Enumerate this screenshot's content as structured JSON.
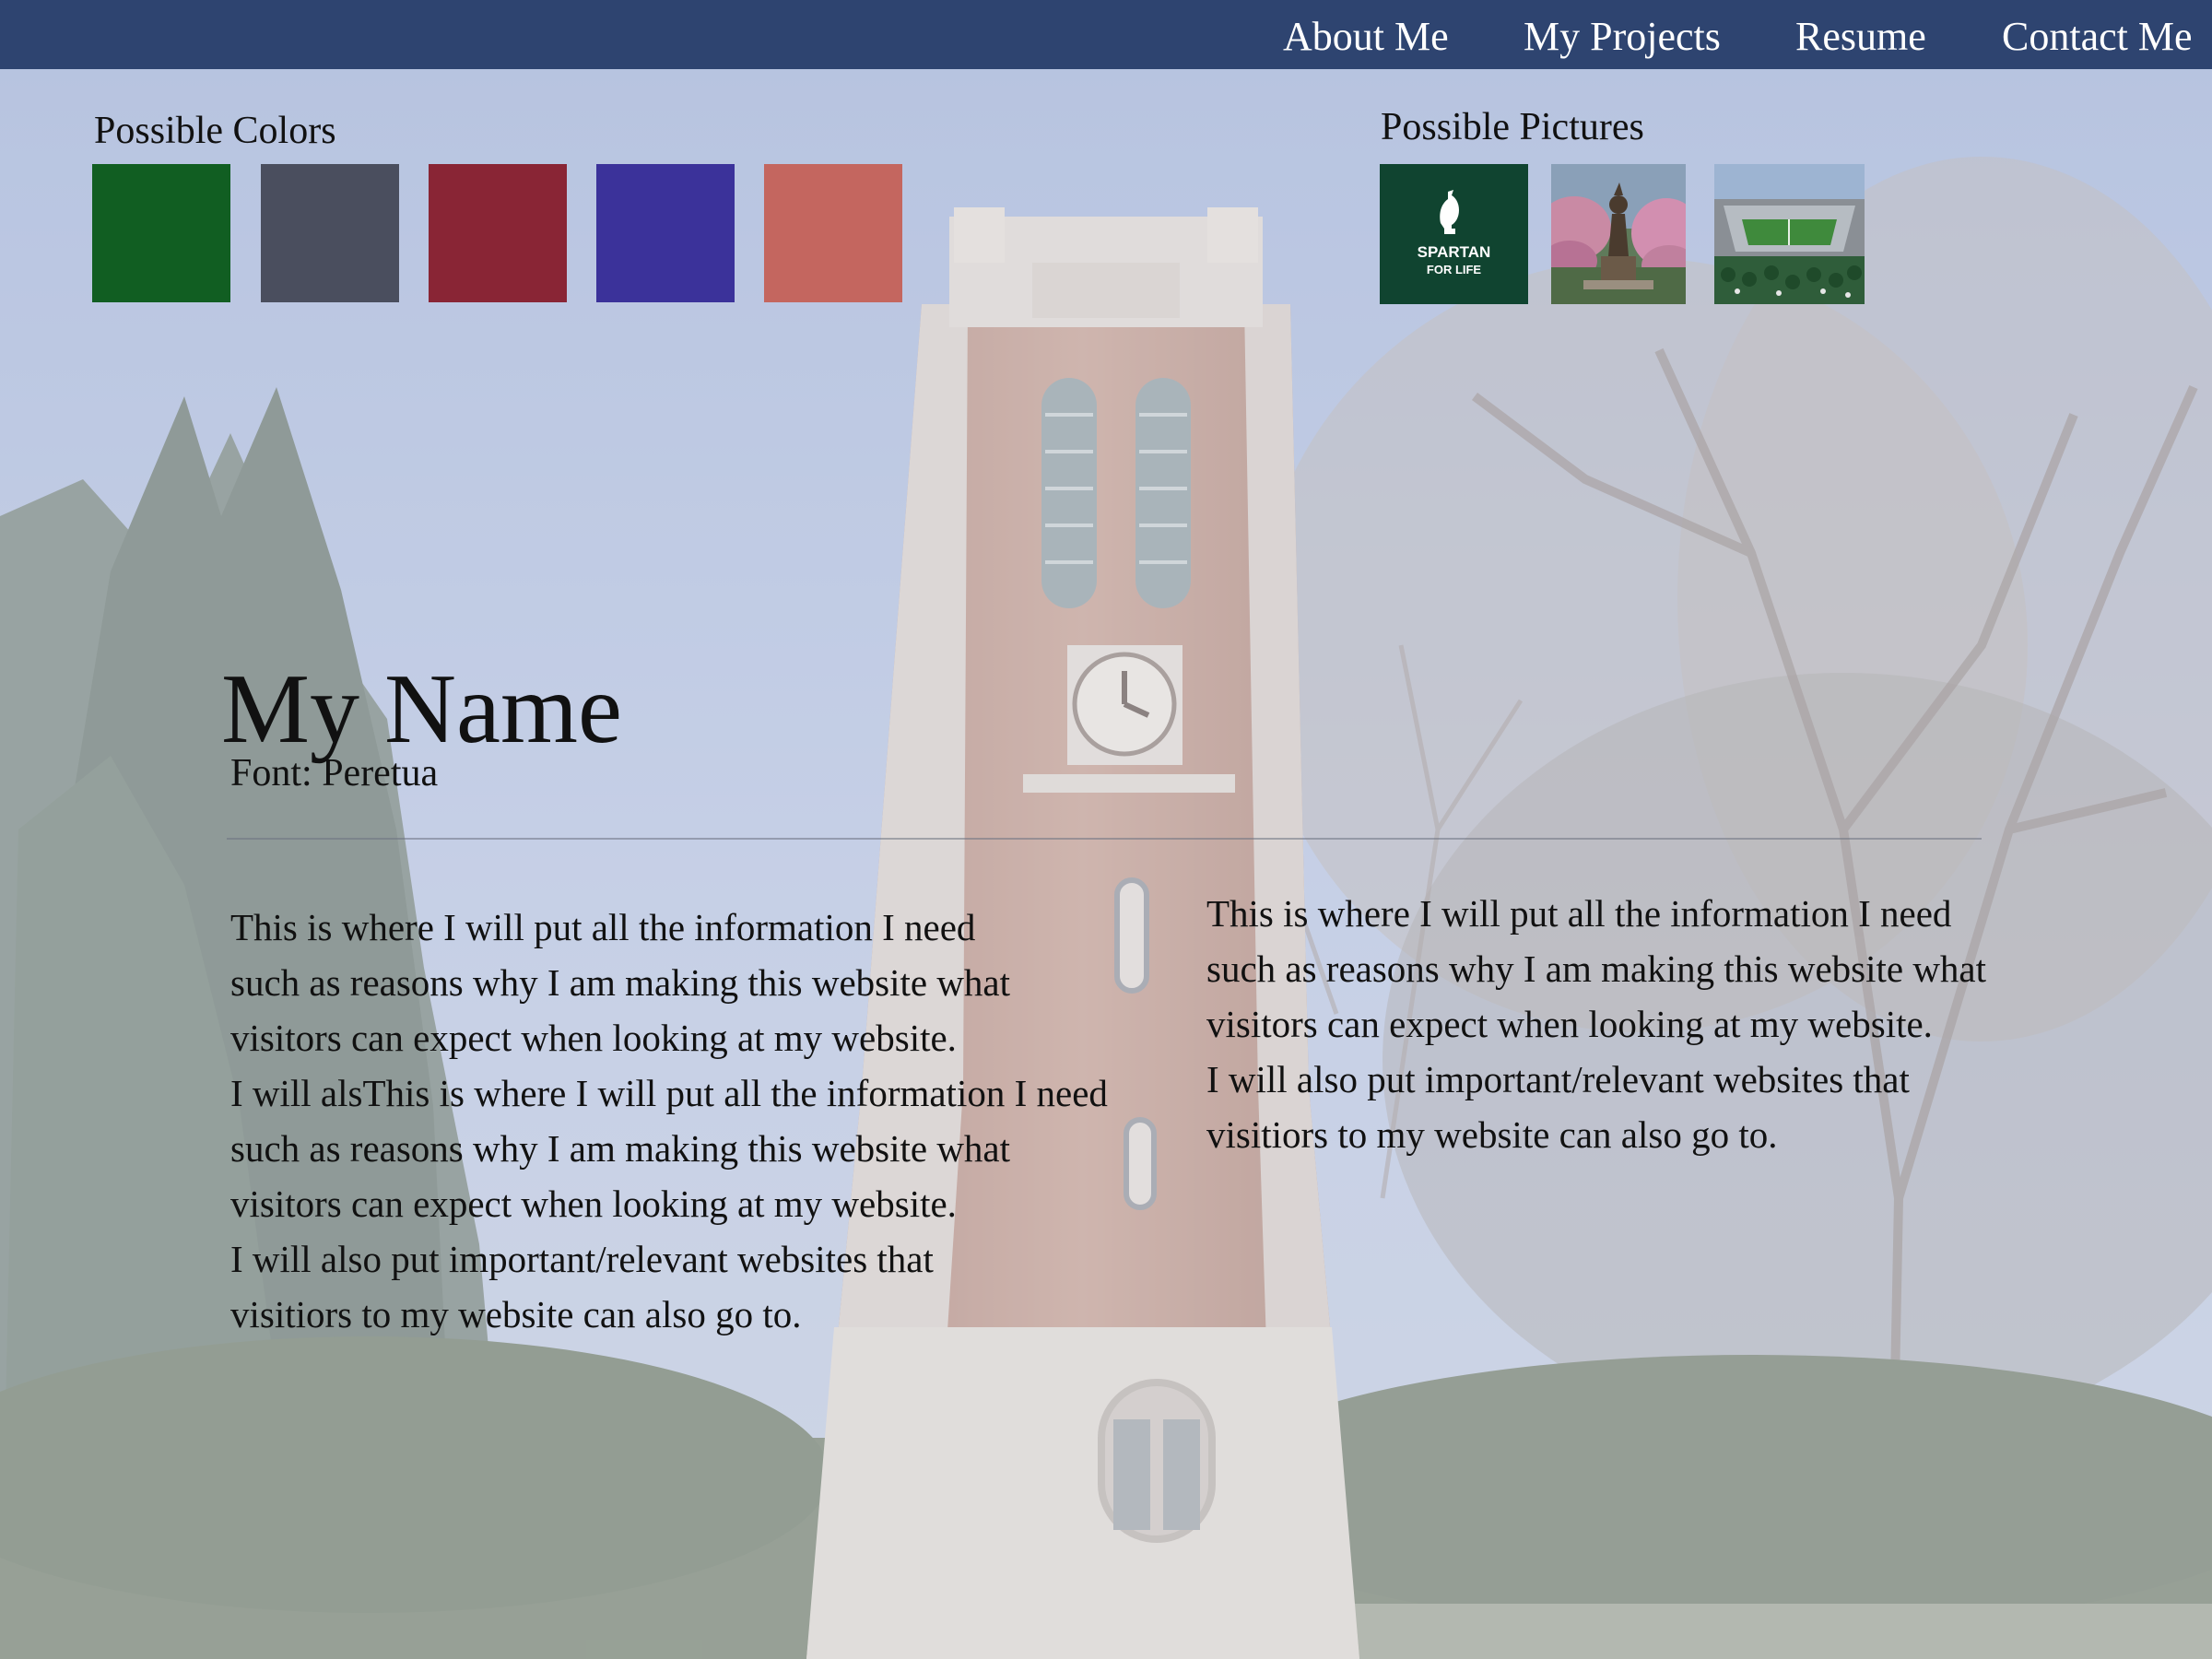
{
  "nav": {
    "items": [
      {
        "label": "About Me"
      },
      {
        "label": "My Projects"
      },
      {
        "label": "Resume"
      },
      {
        "label": "Contact Me"
      }
    ],
    "background": "#2e4470"
  },
  "palette": {
    "label": "Possible Colors",
    "swatches": [
      "#115e22",
      "#4a4e5e",
      "#892535",
      "#3b329a",
      "#c4665f"
    ]
  },
  "pictures": {
    "label": "Possible Pictures",
    "items": [
      {
        "icon": "spartan-logo-image",
        "caption_line1": "SPARTAN",
        "caption_line2": "FOR LIFE"
      },
      {
        "icon": "spartan-statue-image"
      },
      {
        "icon": "stadium-image"
      }
    ]
  },
  "hero": {
    "name": "My Name",
    "font_note": "Font: Peretua"
  },
  "content": {
    "left_lines": [
      "This is where I will put all the information I need",
      "such as reasons why I am making this website what",
      "visitors can expect when looking at my website.",
      "I will alsThis is where I will put all the information I need",
      "such as reasons why I am making this website what",
      "visitors can expect when looking at my website.",
      "I will also put important/relevant websites that",
      "visitiors to my website can also go to."
    ],
    "right_lines": [
      "This is where I will put all the information I need",
      "such as reasons why I am making this website what",
      "visitors can expect when looking at my website.",
      "I will also put important/relevant websites that",
      "visitiors to my website can also go to."
    ]
  },
  "background": {
    "icon": "clock-tower-photo"
  }
}
